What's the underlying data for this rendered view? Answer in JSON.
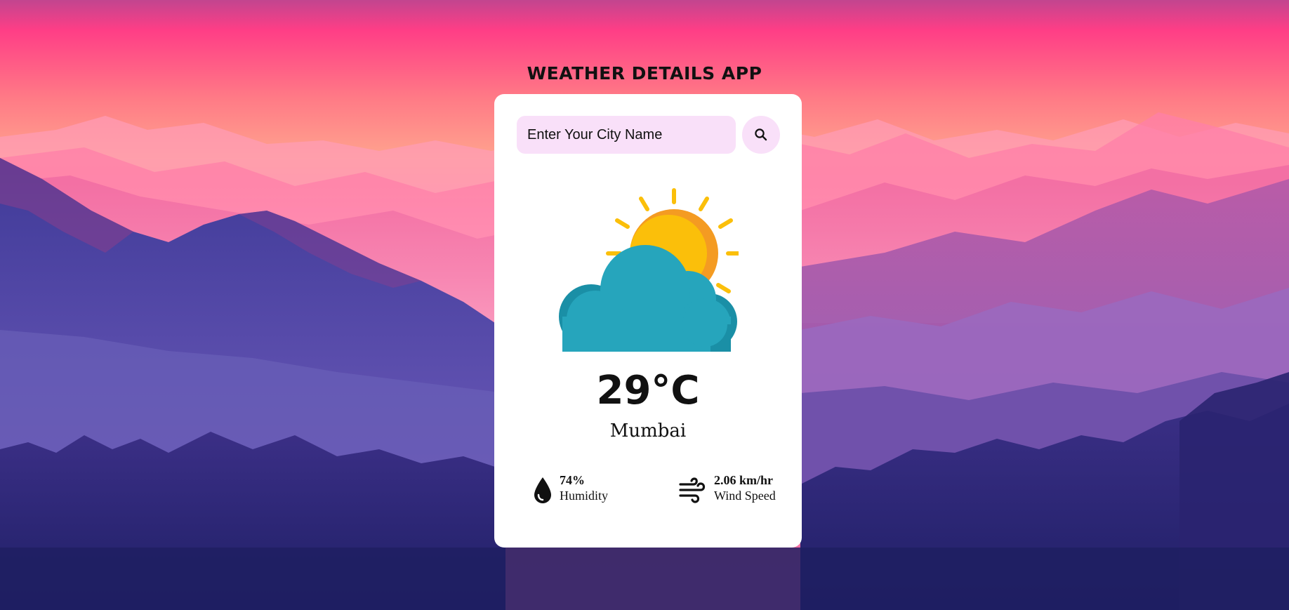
{
  "app": {
    "title": "WEATHER DETAILS APP"
  },
  "search": {
    "placeholder": "Enter Your City Name",
    "value": "",
    "button_icon": "search-icon"
  },
  "weather": {
    "icon": "partly-cloudy-sun-icon",
    "temperature": "29°C",
    "city": "Mumbai"
  },
  "details": {
    "humidity": {
      "icon": "water-drop-icon",
      "value": "74%",
      "label": "Humidity"
    },
    "wind": {
      "icon": "wind-icon",
      "value": "2.06 km/hr",
      "label": "Wind Speed"
    }
  },
  "colors": {
    "card_background": "#ffffff",
    "input_background": "#f9e0f9",
    "sun": "#fbbf0a",
    "sun_shadow": "#f49b22",
    "cloud": "#26a5bc",
    "cloud_shadow": "#1a8fa6",
    "text": "#111111"
  }
}
